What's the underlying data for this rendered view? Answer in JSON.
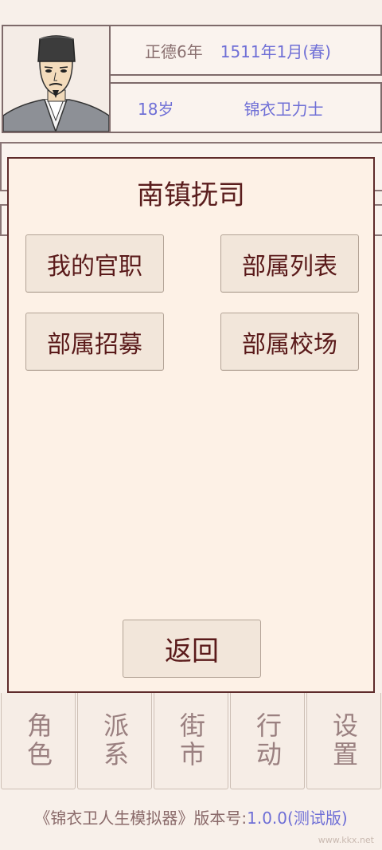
{
  "header": {
    "era": "正德6年",
    "date": "1511年1月(春)",
    "age": "18岁",
    "rank": "锦衣卫力士"
  },
  "modal": {
    "title": "南镇抚司",
    "buttons": [
      "我的官职",
      "部属列表",
      "部属招募",
      "部属校场"
    ],
    "back_label": "返回"
  },
  "nav": [
    "角色",
    "派系",
    "街市",
    "行动",
    "设置"
  ],
  "footer": {
    "game_name": "《锦衣卫人生模拟器》",
    "version_label": "版本号:",
    "version": "1.0.0(测试版)"
  },
  "watermark": "www.kkx.net",
  "colors": {
    "accent_blue": "#6f6fd6",
    "title_red": "#5a1d1d",
    "background": "#f8f0ea"
  }
}
